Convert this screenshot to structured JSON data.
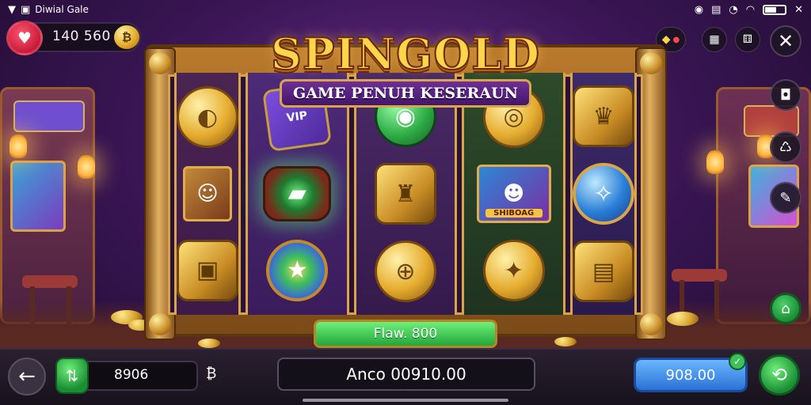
{
  "status_bar": {
    "app_label": "Diwial Gale",
    "left_icons": [
      "signal-icon",
      "app-icon"
    ],
    "right_icons": [
      "notification-icon",
      "sim-icon",
      "alarm-icon",
      "wifi-icon",
      "battery-icon",
      "close-icon"
    ]
  },
  "top_left": {
    "balance": "140 560",
    "coin_symbol": "₿"
  },
  "logo": {
    "title": "SPINGOLD",
    "subtitle": "GAME PENUH KESERAUN"
  },
  "reels": [
    {
      "symbols": [
        "coin-gold",
        "character-miner-small",
        "gold-block"
      ]
    },
    {
      "symbols": [
        "purple-ticket",
        "green-cart",
        "star-coin"
      ]
    },
    {
      "symbols": [
        "green-coin",
        "gold-block",
        "gold-coin"
      ]
    },
    {
      "symbols": [
        "gold-coin",
        "character-card",
        "gold-coin"
      ]
    },
    {
      "symbols": [
        "gold-cup",
        "blue-coin",
        "gold-bars"
      ]
    }
  ],
  "reel_labels": {
    "purple_ticket": "VIP",
    "character_card": "SHIBOAG"
  },
  "play_button": {
    "label": "Flaw. 800"
  },
  "bottom_bar": {
    "bet_value": "8906",
    "currency_symbol": "₿",
    "amount": "Anco 00910.00",
    "win_value": "908.00"
  },
  "colors": {
    "accent_gold": "#ffd54a",
    "play_green": "#22a63a",
    "win_blue": "#2a72d6",
    "gem_red": "#c81b3a"
  }
}
